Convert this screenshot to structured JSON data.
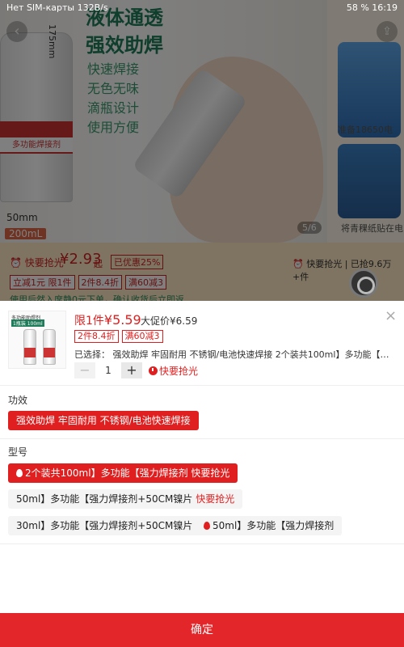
{
  "status_bar": {
    "left": "Нет SIM-карты  132B/s",
    "right": "58 %  16:19"
  },
  "background": {
    "hero_title_line1": "液体通透",
    "hero_title_line2": "强效助焊",
    "features": [
      "快速焊接",
      "无色无味",
      "滴瓶设计",
      "使用方便"
    ],
    "dimension_vertical": "175mm",
    "dimension_width": "50mm",
    "bottle_volume_tag": "200mL",
    "bottle_label": "多功能焊接剂",
    "side_caption_1": "准备18650电",
    "side_caption_2": "将青稞纸贴在电",
    "image_counter": "5/6",
    "rush_label": "快要抢光",
    "price_symbol": "¥",
    "price": "2.93",
    "price_suffix": "起",
    "saved_badge": "已优惠25%",
    "right_rush": "快要抢光 | 已抢9.6万+件",
    "tags": [
      "立减1元 限1件",
      "2件8.4折",
      "满60减3"
    ],
    "promo_line": "使用后然入席静0元下单，确认收货后立即返"
  },
  "sheet": {
    "limit_prefix": "限1件",
    "limit_price": "¥5.59",
    "promo_price": "大促价¥6.59",
    "close_label": "×",
    "offer_tags": [
      "2件8.4折",
      "满60减3"
    ],
    "selected_text": "已选择：  强效助焊 牢固耐用 不锈钢/电池快速焊接 2个装共100ml】多功能【强力...",
    "quantity": "1",
    "minus_label": "−",
    "plus_label": "+",
    "hurry_label": "快要抢光",
    "thumb_title": "多功能助焊剂",
    "thumb_sub": "1瓶装 100ml",
    "section_effect": "功效",
    "effect_option": "强效助焊 牢固耐用 不锈钢/电池快速焊接",
    "section_model": "型号",
    "model_options": [
      {
        "text": "2个装共100ml】多功能【强力焊接剂",
        "hot": "快要抢光"
      },
      {
        "text": "50ml】多功能【强力焊接剂+50CM镍片",
        "hot": "快要抢光"
      },
      {
        "text": "30ml】多功能【强力焊接剂+50CM镍片",
        "hot": ""
      },
      {
        "text": "50ml】多功能【强力焊接剂",
        "hot": ""
      }
    ],
    "confirm_label": "确定"
  },
  "colors": {
    "accent": "#e3262a",
    "price_red": "#e02020",
    "overlay": "rgba(0,0,0,0.5)"
  }
}
